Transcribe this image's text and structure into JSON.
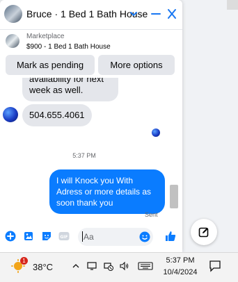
{
  "header": {
    "title": "Bruce · 1 Bed 1 Bath House"
  },
  "listing": {
    "kind": "Marketplace",
    "title": "$900 - 1 Bed 1 Bath House"
  },
  "actions": {
    "pending_label": "Mark as pending",
    "options_label": "More options"
  },
  "messages": {
    "incoming_partial": "availability for next week as well.",
    "incoming_phone": "504.655.4061",
    "timestamp": "5:37 PM",
    "outgoing": "I will Knock you With Adress or more details  as soon thank you",
    "status": "Sent"
  },
  "composer": {
    "placeholder": "Aa"
  },
  "taskbar": {
    "weather_badge": "1",
    "temperature": "38°C",
    "time": "5:37 PM",
    "date": "10/4/2024"
  },
  "colors": {
    "accent": "#0a7cff",
    "bubble_in": "#e4e6eb"
  },
  "icons": {
    "header": [
      "chevron-down-icon",
      "minimize-icon",
      "close-icon"
    ],
    "composer": [
      "plus-icon",
      "photo-icon",
      "sticker-icon",
      "gif-icon",
      "emoji-icon",
      "like-icon"
    ],
    "tray": [
      "chevron-up-icon",
      "monitor-icon",
      "network-icon",
      "volume-icon",
      "keyboard-icon",
      "notification-icon"
    ]
  }
}
